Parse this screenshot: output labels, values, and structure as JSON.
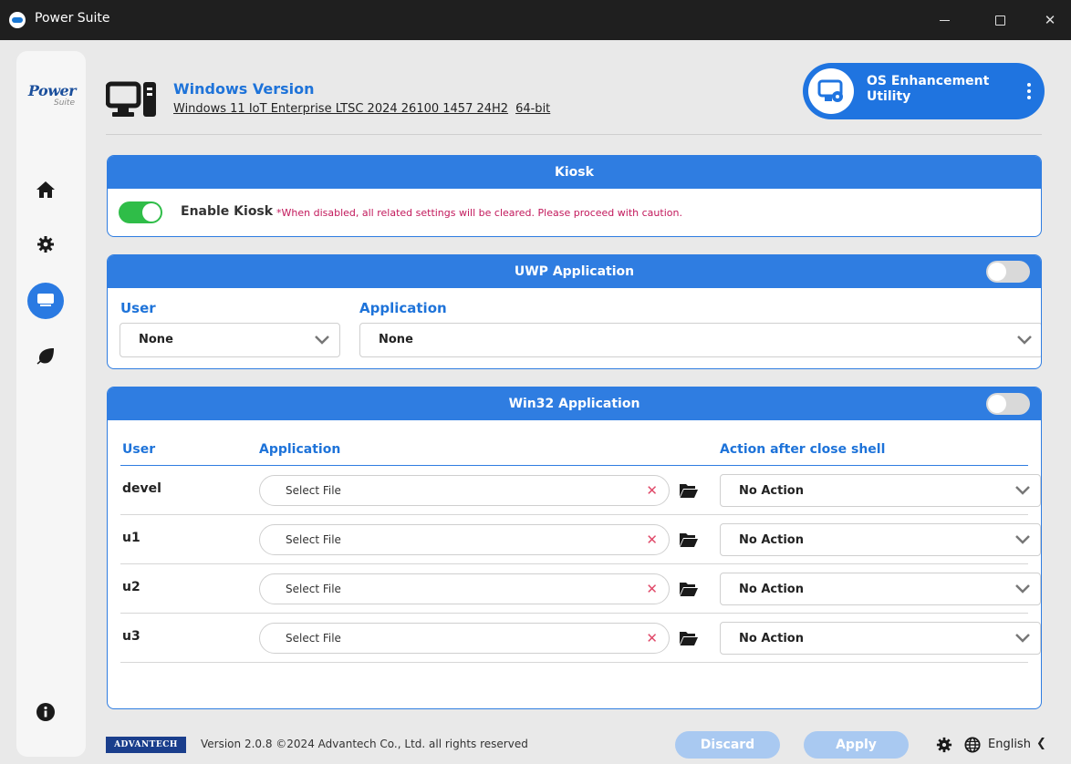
{
  "window": {
    "title": "Power Suite",
    "close_glyph": "✕"
  },
  "sidebar": {
    "brand_main": "Power",
    "brand_sub": "Suite",
    "items": [
      {
        "icon": "home-icon",
        "active": false
      },
      {
        "icon": "gear-icon",
        "active": false
      },
      {
        "icon": "monitor-icon",
        "active": true
      },
      {
        "icon": "leaf-icon",
        "active": false
      },
      {
        "icon": "info-icon",
        "active": false
      }
    ]
  },
  "header": {
    "title": "Windows Version",
    "os_name": "Windows 11 IoT Enterprise LTSC 2024 26100 1457 24H2",
    "arch": "64-bit",
    "utility_line1": "OS Enhancement",
    "utility_line2": "Utility"
  },
  "kiosk": {
    "title": "Kiosk",
    "enabled": true,
    "enable_label": "Enable Kiosk",
    "warning": "*When disabled, all related settings will be cleared. Please proceed with caution."
  },
  "uwp": {
    "title": "UWP Application",
    "enabled": false,
    "user_label": "User",
    "app_label": "Application",
    "user_value": "None",
    "app_value": "None"
  },
  "win32": {
    "title": "Win32 Application",
    "enabled": false,
    "col_user": "User",
    "col_app": "Application",
    "col_action": "Action after close shell",
    "rows": [
      {
        "user": "devel",
        "file_placeholder": "Select File",
        "action": "No Action"
      },
      {
        "user": "u1",
        "file_placeholder": "Select File",
        "action": "No Action"
      },
      {
        "user": "u2",
        "file_placeholder": "Select File",
        "action": "No Action"
      },
      {
        "user": "u3",
        "file_placeholder": "Select File",
        "action": "No Action"
      }
    ]
  },
  "footer": {
    "logo_text": "ADVANTECH",
    "version": "Version 2.0.8 ©2024 Advantech Co., Ltd. all rights reserved",
    "discard_label": "Discard",
    "apply_label": "Apply",
    "language": "English",
    "lang_chevron": "❮"
  },
  "colors": {
    "accent": "#2f7de1",
    "toggle_on": "#2fbd48",
    "warning": "#c2185b",
    "title_bar": "#1f1f1f"
  }
}
